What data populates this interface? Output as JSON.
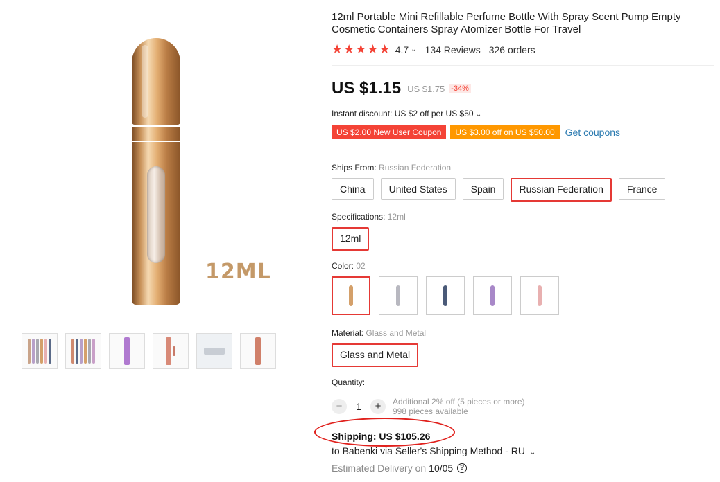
{
  "product": {
    "title": "12ml Portable Mini Refillable Perfume Bottle With Spray Scent Pump Empty Cosmetic Containers Spray Atomizer Bottle For Travel",
    "image_label": "12ML",
    "rating": "4.7",
    "reviews": "134 Reviews",
    "orders": "326 orders",
    "stars": "★★★★★"
  },
  "price": {
    "current": "US $1.15",
    "original": "US $1.75",
    "discount": "-34%"
  },
  "instant_discount": "Instant discount: US $2 off per US $50",
  "coupons": {
    "new_user": "US $2.00 New User Coupon",
    "store": "US $3.00 off on US $50.00",
    "get_label": "Get coupons"
  },
  "ships_from": {
    "label": "Ships From:",
    "value": "Russian Federation",
    "options": [
      "China",
      "United States",
      "Spain",
      "Russian Federation",
      "France"
    ]
  },
  "specifications": {
    "label": "Specifications:",
    "value": "12ml",
    "options": [
      "12ml"
    ]
  },
  "color": {
    "label": "Color:",
    "value": "02",
    "swatches": [
      "#d4a06a",
      "#b8b8c0",
      "#4a5a78",
      "#a888c8",
      "#e8b0b0"
    ]
  },
  "material": {
    "label": "Material:",
    "value": "Glass and Metal",
    "options": [
      "Glass and Metal"
    ]
  },
  "quantity": {
    "label": "Quantity:",
    "value": "1",
    "minus": "−",
    "plus": "+",
    "bulk_note": "Additional 2% off (5 pieces or more)",
    "available": "998 pieces available"
  },
  "shipping": {
    "cost": "Shipping: US $105.26",
    "to": "to Babenki via Seller's Shipping Method - RU",
    "delivery_label": "Estimated Delivery on",
    "delivery_date": "10/05",
    "help_icon": "?"
  },
  "thumbnails": [
    "multi-color-set",
    "multi-color-set-2",
    "purple-bottle",
    "rose-gold-parts",
    "silver-case",
    "rose-gold-bottle"
  ]
}
